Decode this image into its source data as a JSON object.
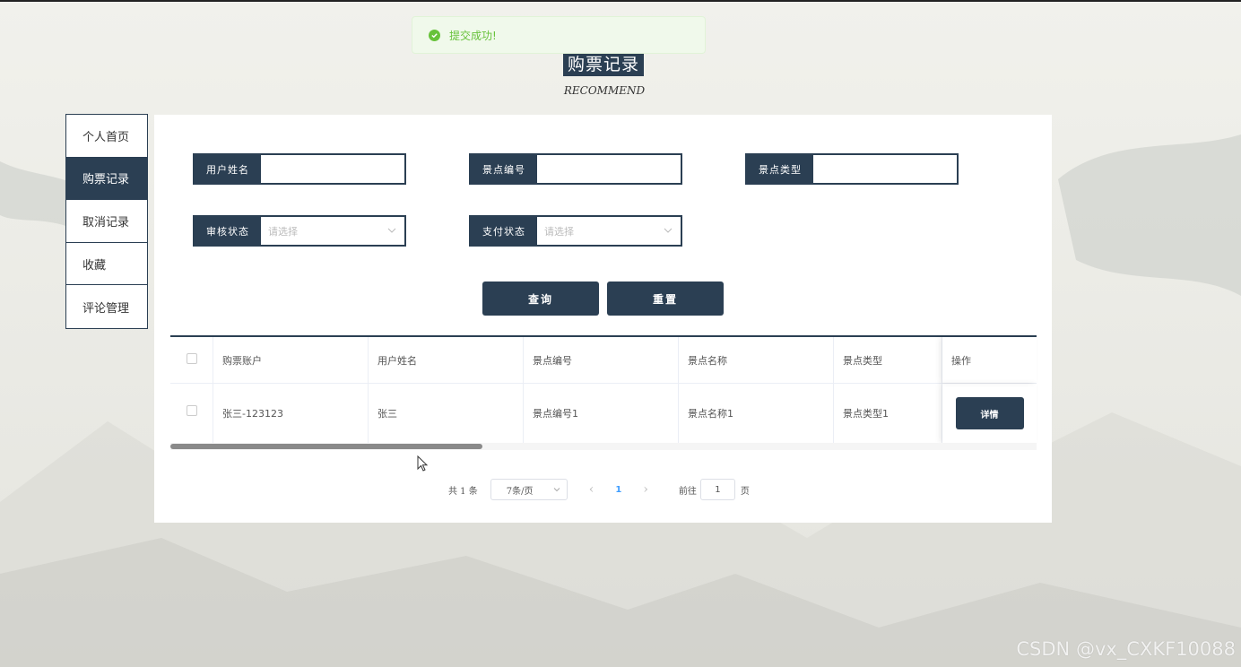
{
  "toast": {
    "text": "提交成功!"
  },
  "page": {
    "title": "购票记录",
    "subtitle": "RECOMMEND"
  },
  "menu": {
    "items": [
      {
        "label": "个人首页",
        "active": false
      },
      {
        "label": "购票记录",
        "active": true
      },
      {
        "label": "取消记录",
        "active": false
      },
      {
        "label": "收藏",
        "active": false
      },
      {
        "label": "评论管理",
        "active": false
      }
    ]
  },
  "search": {
    "fields": [
      {
        "label": "用户姓名",
        "value": ""
      },
      {
        "label": "景点编号",
        "value": ""
      },
      {
        "label": "景点类型",
        "value": ""
      },
      {
        "label": "审核状态",
        "placeholder": "请选择"
      },
      {
        "label": "支付状态",
        "placeholder": "请选择"
      }
    ],
    "query_label": "查询",
    "reset_label": "重置"
  },
  "table": {
    "headers": [
      "购票账户",
      "用户姓名",
      "景点编号",
      "景点名称",
      "景点类型",
      "操作"
    ],
    "rows": [
      {
        "account": "张三-123123",
        "user": "张三",
        "spot_no": "景点编号1",
        "spot_name": "景点名称1",
        "spot_type": "景点类型1",
        "action": "详情"
      }
    ],
    "scroll_fraction": 0.36
  },
  "pagination": {
    "total_text": "共 1 条",
    "page_size": "7条/页",
    "current_page": "1",
    "goto_label": "前往",
    "goto_value": "1",
    "page_suffix": "页"
  },
  "watermark": "CSDN @vx_CXKF10088",
  "colors": {
    "primary": "#2b3f53",
    "success": "#67c23a",
    "link": "#409eff"
  }
}
